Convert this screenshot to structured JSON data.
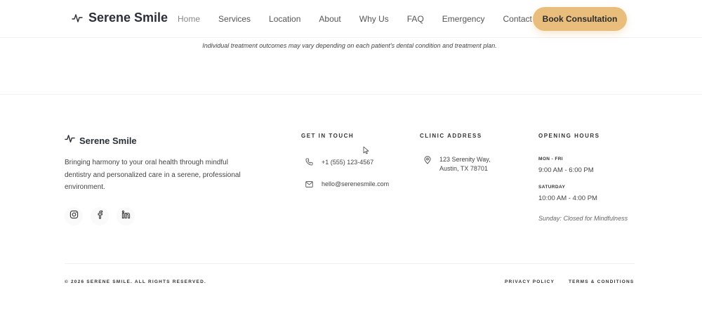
{
  "header": {
    "brand": "Serene Smile",
    "nav": [
      {
        "label": "Home"
      },
      {
        "label": "Services"
      },
      {
        "label": "Location"
      },
      {
        "label": "About"
      },
      {
        "label": "Why Us"
      },
      {
        "label": "FAQ"
      },
      {
        "label": "Emergency"
      },
      {
        "label": "Contact"
      }
    ],
    "cta_label": "Book Consultation",
    "accent_color": "#e9be7c"
  },
  "disclaimer": "Individual treatment outcomes may vary depending on each patient's dental condition and treatment plan.",
  "footer": {
    "brand": "Serene Smile",
    "description": "Bringing harmony to your oral health through mindful dentistry and personalized care in a serene, professional environment.",
    "socials": [
      "instagram-icon",
      "facebook-icon",
      "linkedin-icon"
    ],
    "contact": {
      "title": "GET IN TOUCH",
      "phone": "+1 (555) 123-4567",
      "email": "hello@serenesmile.com"
    },
    "address": {
      "title": "CLINIC ADDRESS",
      "line1": "123 Serenity Way,",
      "line2": "Austin, TX 78701"
    },
    "hours": {
      "title": "OPENING HOURS",
      "weekday_label": "MON - FRI",
      "weekday_hours": "9:00 AM - 6:00 PM",
      "saturday_label": "SATURDAY",
      "saturday_hours": "10:00 AM - 4:00 PM",
      "sunday_note": "Sunday: Closed for Mindfulness"
    },
    "copyright": "© 2026 SERENE SMILE. ALL RIGHTS RESERVED.",
    "privacy": "PRIVACY POLICY",
    "terms": "TERMS & CONDITIONS"
  }
}
